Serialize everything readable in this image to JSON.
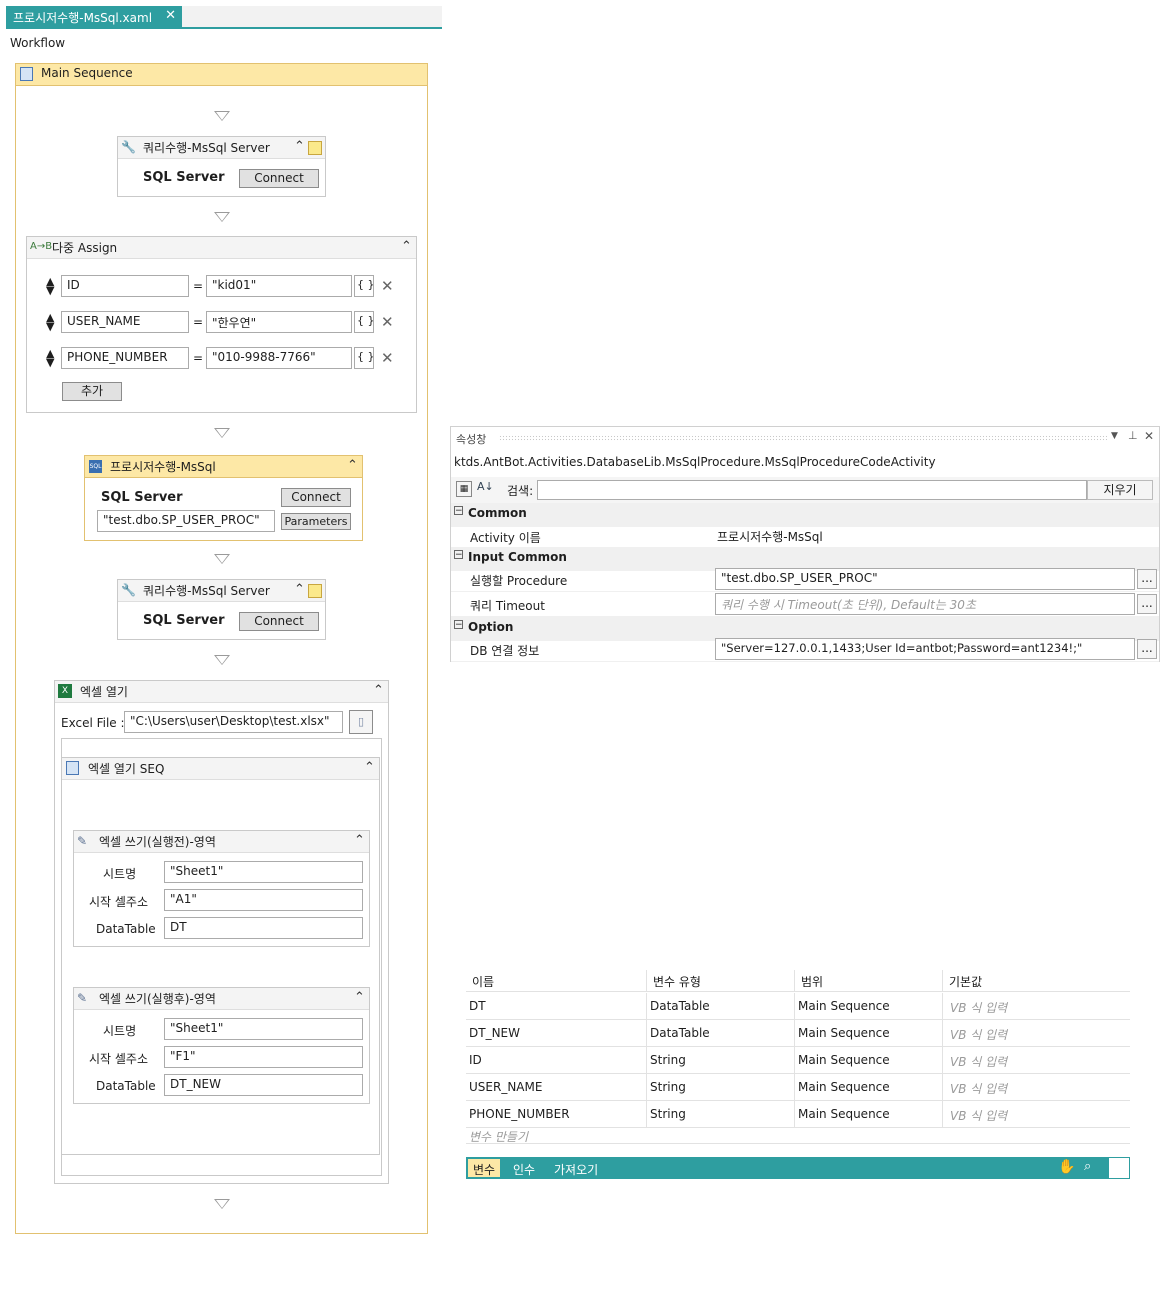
{
  "tab": {
    "title": "프로시저수행-MsSql.xaml",
    "close": "✕"
  },
  "breadcrumb": "Workflow",
  "main_sequence": {
    "title": "Main Sequence"
  },
  "query1": {
    "title": "쿼리수행-MsSql Server",
    "server_label": "SQL Server",
    "connect": "Connect"
  },
  "multi_assign": {
    "title": "다중 Assign",
    "rows": [
      {
        "to": "ID",
        "value": "\"kid01\""
      },
      {
        "to": "USER_NAME",
        "value": "\"한우연\""
      },
      {
        "to": "PHONE_NUMBER",
        "value": "\"010-9988-7766\""
      }
    ],
    "eq": "=",
    "braces": "{ }",
    "add": "추가"
  },
  "procedure": {
    "title": "프로시저수행-MsSql",
    "server_label": "SQL Server",
    "connect": "Connect",
    "proc": "\"test.dbo.SP_USER_PROC\"",
    "parameters": "Parameters"
  },
  "query2": {
    "title": "쿼리수행-MsSql Server",
    "server_label": "SQL Server",
    "connect": "Connect"
  },
  "excel_open": {
    "title": "엑셀 열기",
    "file_label": "Excel File :",
    "file": "\"C:\\Users\\user\\Desktop\\test.xlsx\""
  },
  "excel_seq": {
    "title": "엑셀 열기 SEQ"
  },
  "write_before": {
    "title": "엑셀 쓰기(실행전)-영역",
    "sheet_label": "시트명",
    "sheet": "\"Sheet1\"",
    "cell_label": "시작 셀주소",
    "cell": "\"A1\"",
    "dt_label": "DataTable",
    "dt": "DT"
  },
  "write_after": {
    "title": "엑셀 쓰기(실행후)-영역",
    "sheet_label": "시트명",
    "sheet": "\"Sheet1\"",
    "cell_label": "시작 셀주소",
    "cell": "\"F1\"",
    "dt_label": "DataTable",
    "dt": "DT_NEW"
  },
  "properties": {
    "title": "속성창",
    "class_name": "ktds.AntBot.Activities.DatabaseLib.MsSqlProcedure.MsSqlProcedureCodeActivity",
    "search_label": "검색:",
    "clear": "지우기",
    "categories": {
      "common": "Common",
      "input_common": "Input Common",
      "option": "Option"
    },
    "rows": {
      "activity_name_label": "Activity 이름",
      "activity_name": "프로시저수행-MsSql",
      "procedure_label": "실행할 Procedure",
      "procedure": "\"test.dbo.SP_USER_PROC\"",
      "timeout_label": "쿼리 Timeout",
      "timeout_placeholder": "쿼리 수행 시 Timeout(초 단위), Default는 30초",
      "db_label": "DB 연결 정보",
      "db": "\"Server=127.0.0.1,1433;User Id=antbot;Password=ant1234!;\""
    },
    "ellipsis": "..."
  },
  "variables": {
    "headers": [
      "이름",
      "변수 유형",
      "범위",
      "기본값"
    ],
    "rows": [
      {
        "name": "DT",
        "type": "DataTable",
        "scope": "Main Sequence",
        "default": "VB 식 입력"
      },
      {
        "name": "DT_NEW",
        "type": "DataTable",
        "scope": "Main Sequence",
        "default": "VB 식 입력"
      },
      {
        "name": "ID",
        "type": "String",
        "scope": "Main Sequence",
        "default": "VB 식 입력"
      },
      {
        "name": "USER_NAME",
        "type": "String",
        "scope": "Main Sequence",
        "default": "VB 식 입력"
      },
      {
        "name": "PHONE_NUMBER",
        "type": "String",
        "scope": "Main Sequence",
        "default": "VB 식 입력"
      }
    ],
    "create": "변수 만들기",
    "tabs": {
      "variables": "변수",
      "arguments": "인수",
      "imports": "가져오기"
    }
  },
  "colors": {
    "accent": "#2e9ea0",
    "sequence_header": "#fde8a6"
  }
}
